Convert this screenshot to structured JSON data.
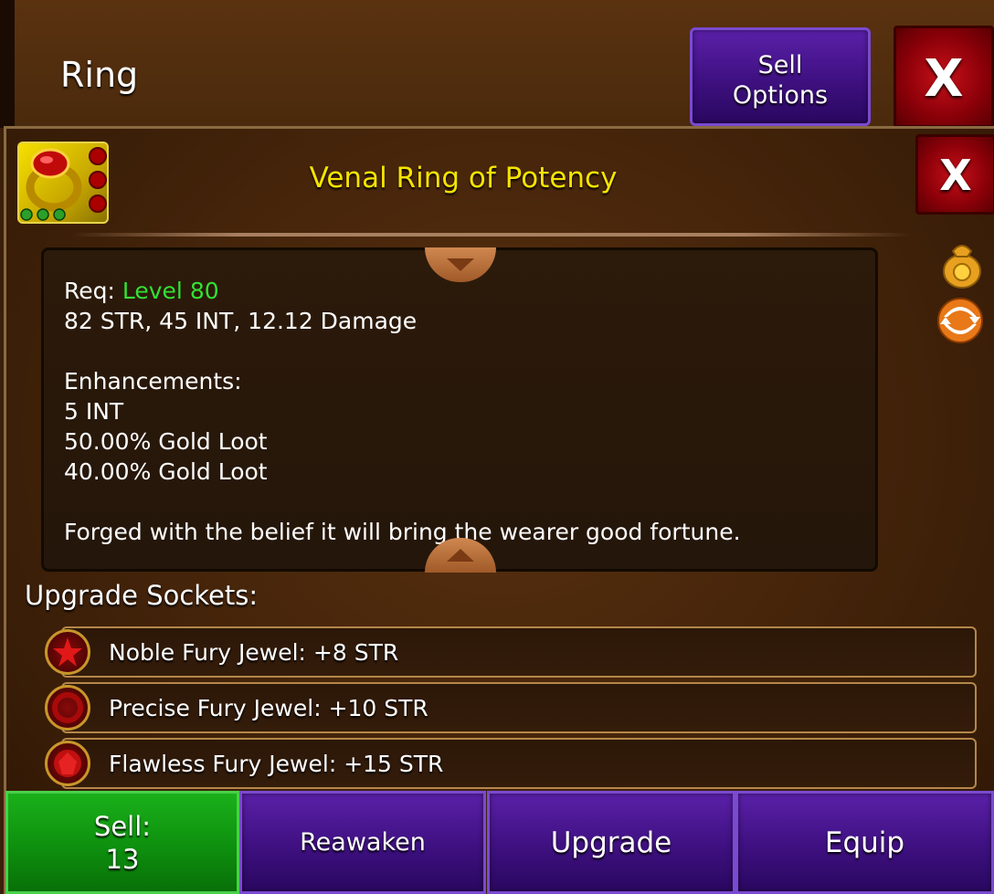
{
  "header": {
    "title": "Ring",
    "sell_options_label": "Sell\nOptions",
    "close_label": "X"
  },
  "item": {
    "name": "Venal Ring of Potency",
    "close_label": "X",
    "name_color": "#f5e400"
  },
  "description": {
    "req_prefix": "Req: ",
    "req_value": "Level 80",
    "stats": "82 STR, 45 INT, 12.12 Damage",
    "enhancements_heading": "Enhancements:",
    "enhancements": [
      "5 INT",
      "50.00% Gold Loot",
      "40.00% Gold Loot"
    ],
    "flavor": "Forged with the belief it will bring the wearer good fortune."
  },
  "side_icons": [
    "gold-bag-icon",
    "reroll-arrows-icon"
  ],
  "sockets": {
    "heading": "Upgrade Sockets:",
    "items": [
      {
        "label": "Noble Fury Jewel: +8 STR",
        "icon": "star-gem-icon"
      },
      {
        "label": "Precise Fury Jewel: +10 STR",
        "icon": "round-gem-icon"
      },
      {
        "label": "Flawless Fury Jewel: +15 STR",
        "icon": "faceted-gem-icon"
      }
    ]
  },
  "actions": {
    "sell_label": "Sell:",
    "sell_value": "13",
    "reawaken_label": "Reawaken",
    "upgrade_label": "Upgrade",
    "equip_label": "Equip"
  },
  "colors": {
    "level_green": "#33e033",
    "button_purple": "#3e1080",
    "button_red": "#8a0008",
    "button_green": "#0e900e"
  }
}
